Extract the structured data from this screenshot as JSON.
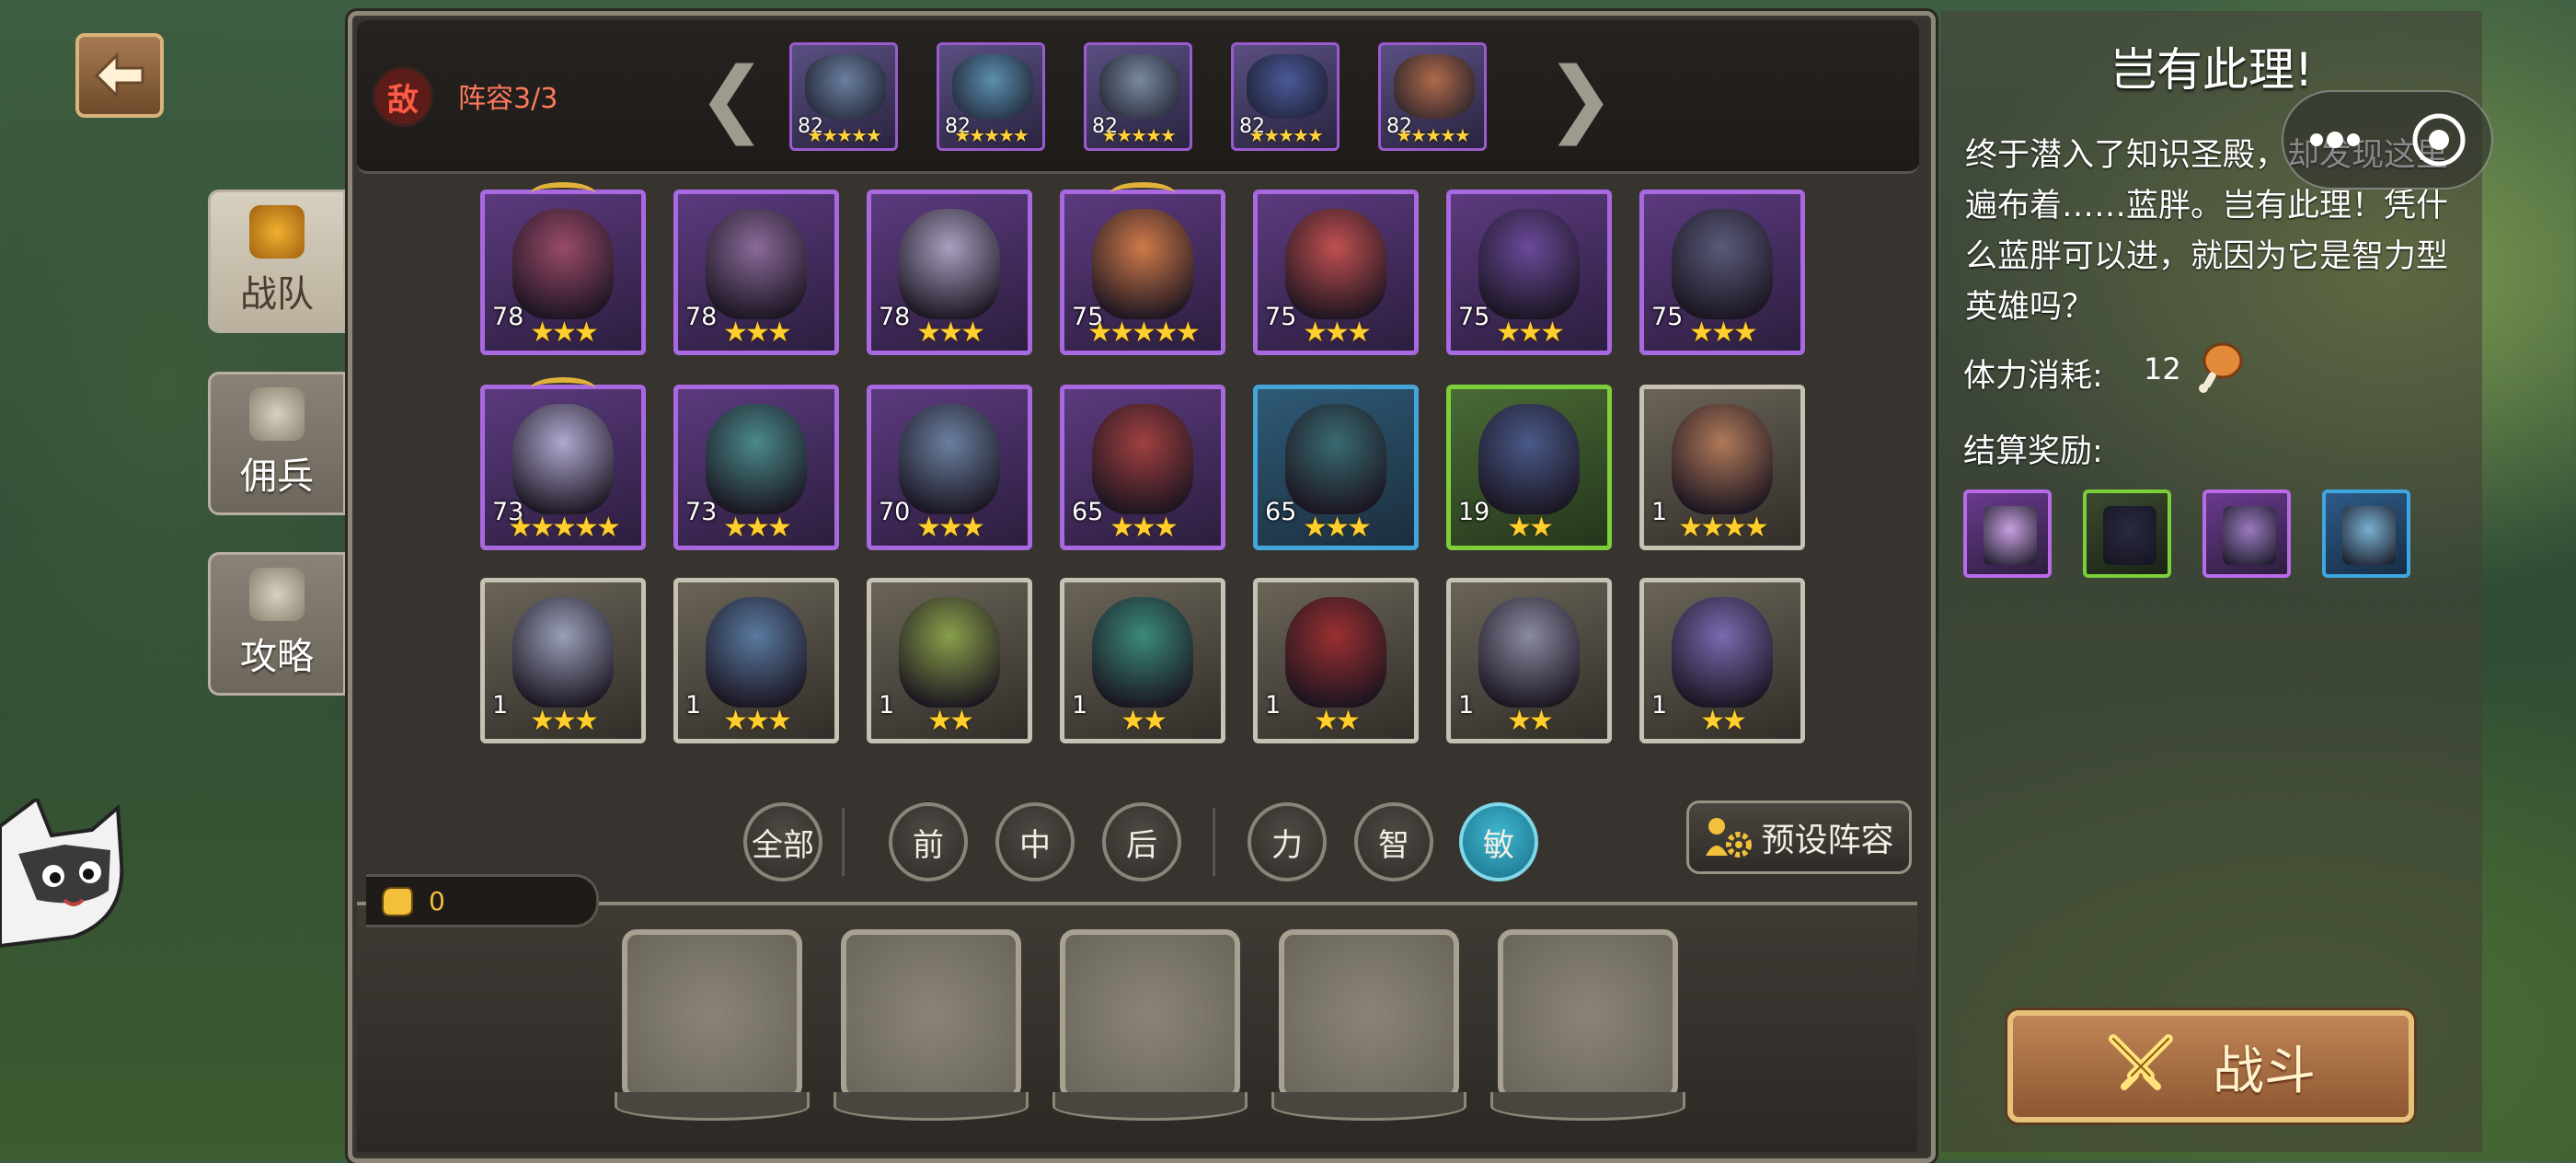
{
  "header": {
    "enemy_badge": "敌",
    "lineup_label": "阵容3/3",
    "prev_arrow": "❮",
    "next_arrow": "❯"
  },
  "enemies": [
    {
      "level": "82",
      "stars": "★★★★★",
      "color": "#6a7fa0"
    },
    {
      "level": "82",
      "stars": "★★★★★",
      "color": "#5b8fb0"
    },
    {
      "level": "82",
      "stars": "★★★★★",
      "color": "#7a8aa0"
    },
    {
      "level": "82",
      "stars": "★★★★★",
      "color": "#4a5a9a"
    },
    {
      "level": "82",
      "stars": "★★★★★",
      "color": "#b06a4a"
    }
  ],
  "side_tabs": [
    {
      "label": "战队",
      "icon": "helmet-icon",
      "active": true
    },
    {
      "label": "佣兵",
      "icon": "knight-helmet-icon",
      "active": false
    },
    {
      "label": "攻略",
      "icon": "book-icon",
      "active": false
    }
  ],
  "heroes": [
    {
      "level": "78",
      "stars": "★★★",
      "rarity": "purple",
      "crown": true,
      "color": "#9a4a6a"
    },
    {
      "level": "78",
      "stars": "★★★",
      "rarity": "purple",
      "crown": false,
      "color": "#8a6a9a"
    },
    {
      "level": "78",
      "stars": "★★★",
      "rarity": "purple",
      "crown": false,
      "color": "#a8a0c0"
    },
    {
      "level": "75",
      "stars": "★★★★★",
      "rarity": "purple",
      "crown": true,
      "color": "#d07a4a"
    },
    {
      "level": "75",
      "stars": "★★★",
      "rarity": "purple",
      "crown": false,
      "color": "#c05050"
    },
    {
      "level": "75",
      "stars": "★★★",
      "rarity": "purple",
      "crown": false,
      "color": "#6a4a9a"
    },
    {
      "level": "75",
      "stars": "★★★",
      "rarity": "purple",
      "crown": false,
      "color": "#5a5a7a"
    },
    {
      "level": "73",
      "stars": "★★★★★",
      "rarity": "purple",
      "crown": true,
      "color": "#b0a8d0"
    },
    {
      "level": "73",
      "stars": "★★★",
      "rarity": "purple",
      "crown": false,
      "color": "#4a8a8a"
    },
    {
      "level": "70",
      "stars": "★★★",
      "rarity": "purple",
      "crown": false,
      "color": "#6a80a0"
    },
    {
      "level": "65",
      "stars": "★★★",
      "rarity": "purple",
      "crown": false,
      "color": "#a04040"
    },
    {
      "level": "65",
      "stars": "★★★",
      "rarity": "blue",
      "crown": false,
      "color": "#3a6a70"
    },
    {
      "level": "19",
      "stars": "★★",
      "rarity": "green",
      "crown": false,
      "color": "#4a5a8a"
    },
    {
      "level": "1",
      "stars": "★★★★",
      "rarity": "white",
      "crown": false,
      "color": "#b07a5a"
    },
    {
      "level": "1",
      "stars": "★★★",
      "rarity": "white",
      "crown": false,
      "color": "#9aa0b8"
    },
    {
      "level": "1",
      "stars": "★★★",
      "rarity": "white",
      "crown": false,
      "color": "#5a7aa0"
    },
    {
      "level": "1",
      "stars": "★★",
      "rarity": "white",
      "crown": false,
      "color": "#8aa04a"
    },
    {
      "level": "1",
      "stars": "★★",
      "rarity": "white",
      "crown": false,
      "color": "#3a8a7a"
    },
    {
      "level": "1",
      "stars": "★★",
      "rarity": "white",
      "crown": false,
      "color": "#9a3030"
    },
    {
      "level": "1",
      "stars": "★★",
      "rarity": "white",
      "crown": false,
      "color": "#8a8aa0"
    },
    {
      "level": "1",
      "stars": "★★",
      "rarity": "white",
      "crown": false,
      "color": "#7a6ab0"
    }
  ],
  "filters": {
    "all": "全部",
    "front": "前",
    "middle": "中",
    "back": "后",
    "strength": "力",
    "intellect": "智",
    "agility": "敏",
    "active_filter": "agility"
  },
  "preset_label": "预设阵容",
  "power_value": "0",
  "slots_count_visible": 5,
  "stage": {
    "title": "岂有此理!",
    "description": "终于潜入了知识圣殿，却发现这里遍布着……蓝胖。岂有此理！凭什么蓝胖可以进，就因为它是智力型英雄吗？",
    "stamina_label": "体力消耗:",
    "stamina_value": "12",
    "reward_label": "结算奖励:",
    "rewards": [
      {
        "rarity": "purple",
        "color": "#c8a0e0",
        "icon": "scroll-icon"
      },
      {
        "rarity": "green",
        "color": "#2a2a40",
        "icon": "hood-icon"
      },
      {
        "rarity": "purple",
        "color": "#9a7ac0",
        "icon": "armor-icon"
      },
      {
        "rarity": "blue",
        "color": "#7ab0d0",
        "icon": "mace-icon"
      }
    ]
  },
  "battle_label": "战斗",
  "colors": {
    "accent_red": "#ff5a46",
    "star_gold": "#ffcf2e",
    "active_filter": "#3fb8d0",
    "battle_button": "#a56c40"
  }
}
